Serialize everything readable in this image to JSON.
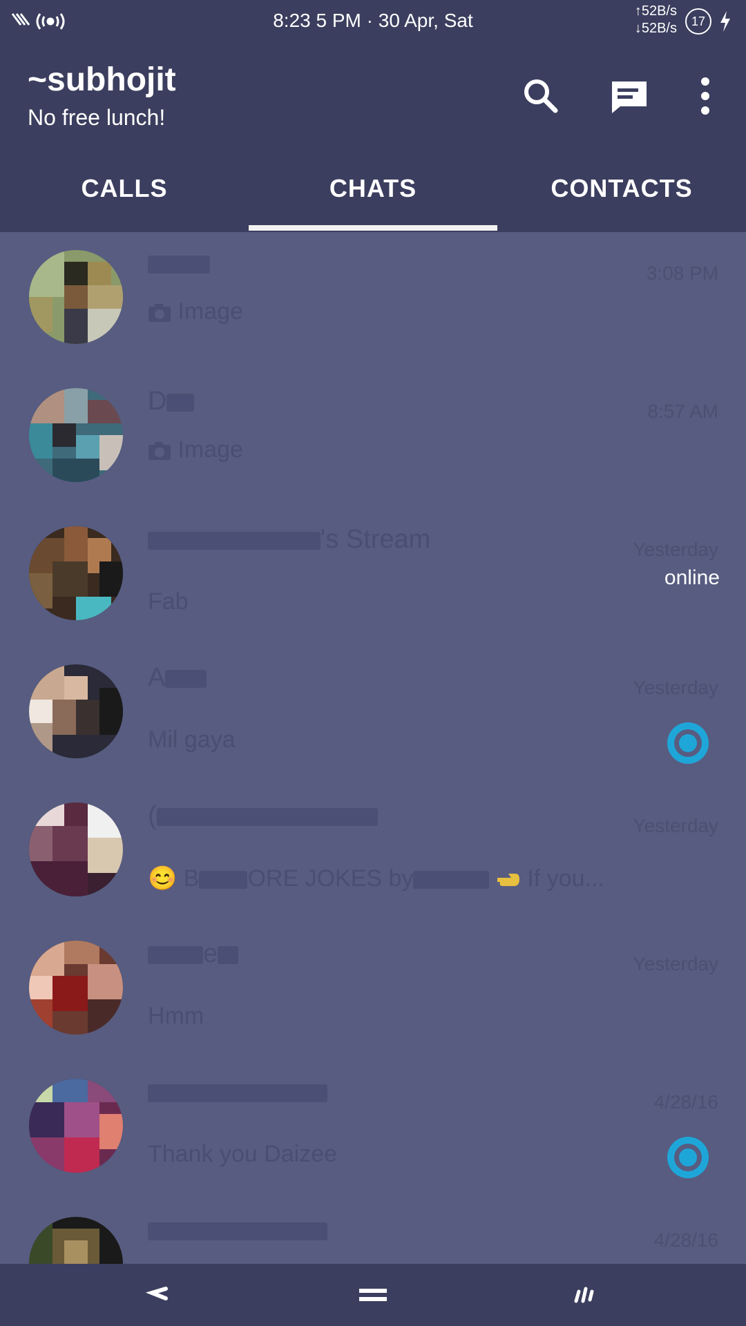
{
  "status_bar": {
    "datetime": "8:23 5 PM · 30 Apr, Sat",
    "upload_speed": "↑52B/s",
    "download_speed": "↓52B/s",
    "battery": "17"
  },
  "header": {
    "title": "~subhojit",
    "subtitle": "No free lunch!",
    "icons": [
      "search-icon",
      "new-message-icon",
      "more-vert-icon"
    ]
  },
  "tabs": [
    {
      "label": "CALLS",
      "selected": false
    },
    {
      "label": "CHATS",
      "selected": true
    },
    {
      "label": "CONTACTS",
      "selected": false
    }
  ],
  "chats": [
    {
      "name": "",
      "time": "3:08 PM",
      "preview": "Image",
      "preview_icon": "camera-icon"
    },
    {
      "name": "D",
      "time": "8:57 AM",
      "preview": "Image",
      "preview_icon": "camera-icon"
    },
    {
      "name": "'s Stream",
      "time": "Yesterday",
      "preview": "Fab",
      "status": "online"
    },
    {
      "name": "A",
      "time": "Yesterday",
      "preview": "Mil gaya",
      "unread": true
    },
    {
      "name": "(",
      "time": "Yesterday",
      "preview": "ORE JOKES by",
      "preview_prefix": "B",
      "preview_suffix": "If you...",
      "emoji": "😊"
    },
    {
      "name": "e",
      "time": "Yesterday",
      "preview": "Hmm"
    },
    {
      "name": "",
      "time": "4/28/16",
      "preview": "Thank you Daizee",
      "unread": true
    },
    {
      "name": "",
      "time": "4/28/16",
      "preview": ""
    }
  ],
  "colors": {
    "header_bg": "#3b3e5e",
    "list_bg": "#575c80",
    "accent_unread": "#1fa6d9"
  }
}
